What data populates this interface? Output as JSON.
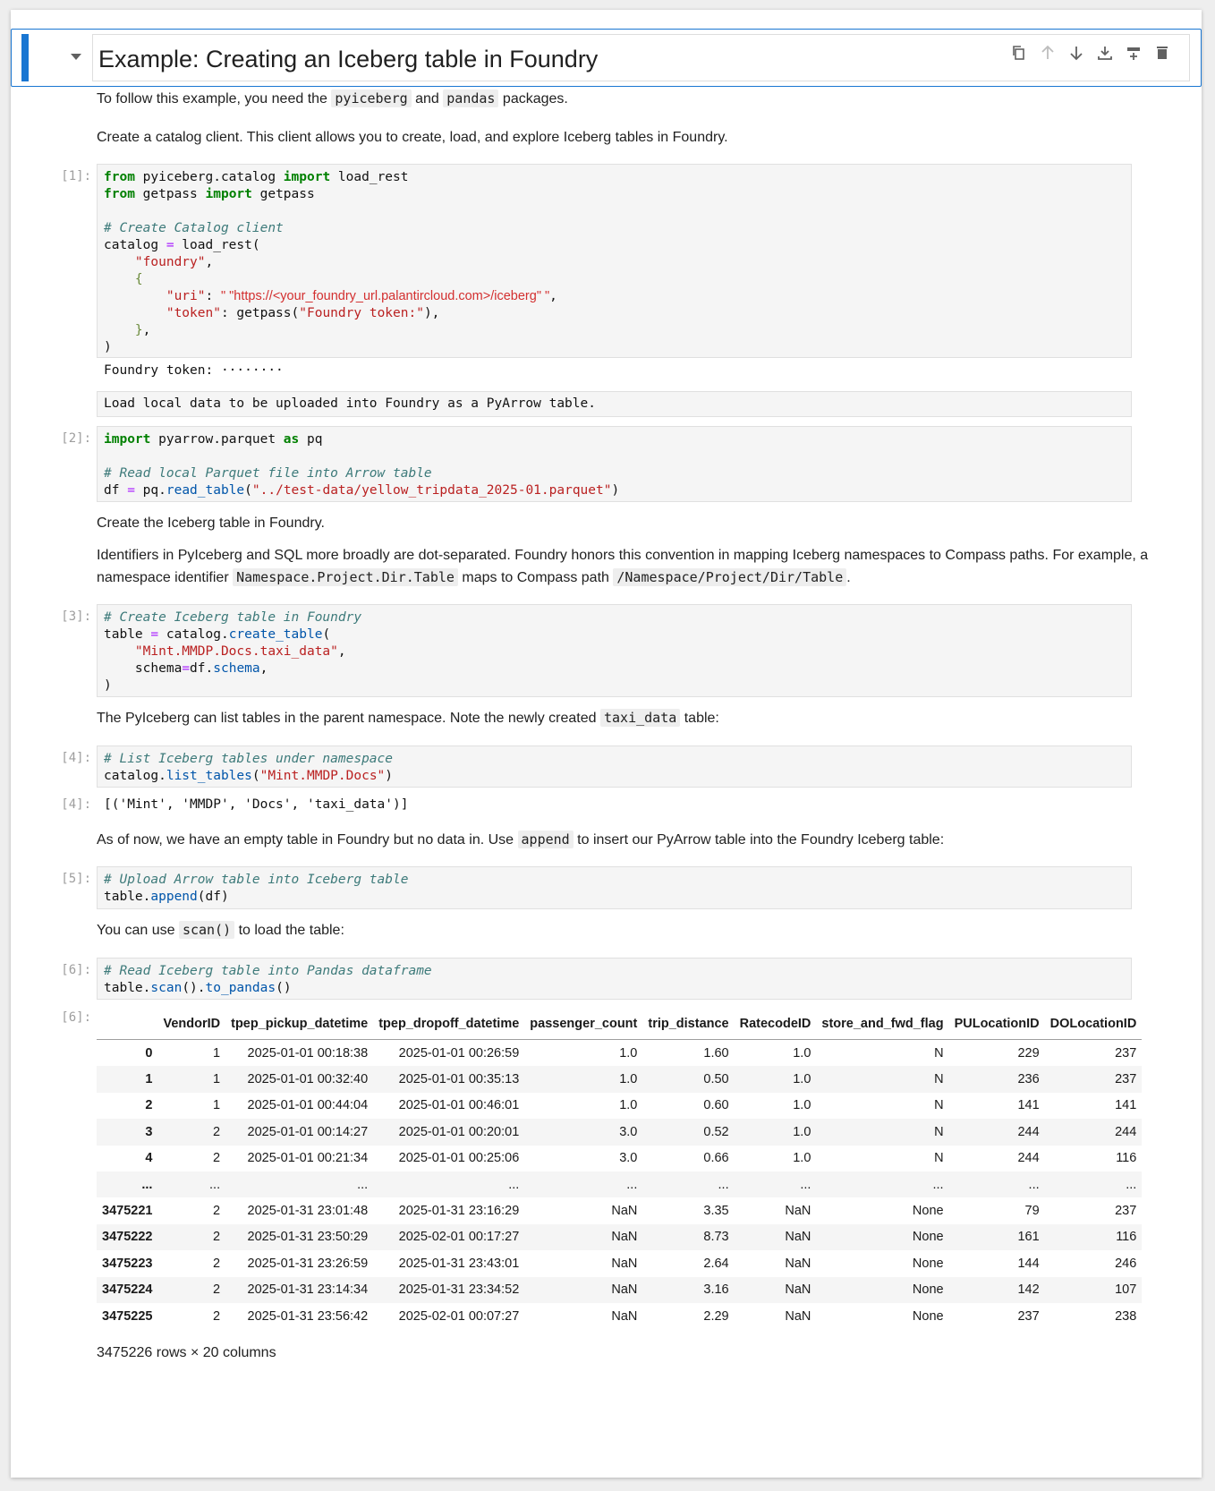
{
  "title": "Example: Creating an Iceberg table in Foundry",
  "toolbar": [
    "copy-icon",
    "move-up-icon",
    "move-down-icon",
    "insert-below-icon",
    "insert-above-icon",
    "delete-icon"
  ],
  "md1": {
    "pre": "To follow this example, you need the",
    "code1": "pyiceberg",
    "mid": "and",
    "code2": "pandas",
    "post": "packages."
  },
  "md2": "Create a catalog client. This client allows you to create, load, and explore Iceberg tables in Foundry.",
  "cell1": {
    "prompt": "[1]:",
    "comment": "# Create Catalog client",
    "foundry": "\"foundry\"",
    "uri_key": "\"uri\"",
    "uri_value": "\" \"https://<your_foundry_url.palantircloud.com>/iceberg\" \"",
    "token_key": "\"token\"",
    "token_prompt": "\"Foundry token:\""
  },
  "out1": "Foundry token: ········",
  "raw1": "Load local data to be uploaded into Foundry as a PyArrow table.",
  "cell2": {
    "prompt": "[2]:",
    "comment": "# Read local Parquet file into Arrow table",
    "path": "\"../test-data/yellow_tripdata_2025-01.parquet\""
  },
  "md3": "Create the Iceberg table in Foundry.",
  "md4": {
    "line1": "Identifiers in PyIceberg and SQL more broadly are dot-separated. Foundry honors this convention in mapping Iceberg namespaces to Compass paths. For example, a",
    "pre": "namespace identifier",
    "code1": "Namespace.Project.Dir.Table",
    "mid": "maps to Compass path",
    "code2": "/Namespace/Project/Dir/Table",
    "post": "."
  },
  "cell3": {
    "prompt": "[3]:",
    "comment": "# Create Iceberg table in Foundry",
    "name": "\"Mint.MMDP.Docs.taxi_data\""
  },
  "md5": {
    "pre": "The PyIceberg can list tables in the parent namespace. Note the newly created",
    "code": "taxi_data",
    "post": "table:"
  },
  "cell4": {
    "prompt": "[4]:",
    "comment": "# List Iceberg tables under namespace",
    "ns": "\"Mint.MMDP.Docs\""
  },
  "out4": {
    "prompt": "[4]:",
    "text": "[('Mint', 'MMDP', 'Docs', 'taxi_data')]"
  },
  "md6": {
    "pre": "As of now, we have an empty table in Foundry but no data in. Use",
    "code": "append",
    "post": "to insert our PyArrow table into the Foundry Iceberg table:"
  },
  "cell5": {
    "prompt": "[5]:",
    "comment": "# Upload Arrow table into Iceberg table"
  },
  "md7": {
    "pre": "You can use",
    "code": "scan()",
    "post": "to load the table:"
  },
  "cell6": {
    "prompt": "[6]:",
    "comment": "# Read Iceberg table into Pandas dataframe"
  },
  "out6": {
    "prompt": "[6]:",
    "columns": [
      "",
      "VendorID",
      "tpep_pickup_datetime",
      "tpep_dropoff_datetime",
      "passenger_count",
      "trip_distance",
      "RatecodeID",
      "store_and_fwd_flag",
      "PULocationID",
      "DOLocationID"
    ],
    "rows": [
      [
        "0",
        "1",
        "2025-01-01 00:18:38",
        "2025-01-01 00:26:59",
        "1.0",
        "1.60",
        "1.0",
        "N",
        "229",
        "237"
      ],
      [
        "1",
        "1",
        "2025-01-01 00:32:40",
        "2025-01-01 00:35:13",
        "1.0",
        "0.50",
        "1.0",
        "N",
        "236",
        "237"
      ],
      [
        "2",
        "1",
        "2025-01-01 00:44:04",
        "2025-01-01 00:46:01",
        "1.0",
        "0.60",
        "1.0",
        "N",
        "141",
        "141"
      ],
      [
        "3",
        "2",
        "2025-01-01 00:14:27",
        "2025-01-01 00:20:01",
        "3.0",
        "0.52",
        "1.0",
        "N",
        "244",
        "244"
      ],
      [
        "4",
        "2",
        "2025-01-01 00:21:34",
        "2025-01-01 00:25:06",
        "3.0",
        "0.66",
        "1.0",
        "N",
        "244",
        "116"
      ],
      [
        "...",
        "...",
        "...",
        "...",
        "...",
        "...",
        "...",
        "...",
        "...",
        "..."
      ],
      [
        "3475221",
        "2",
        "2025-01-31 23:01:48",
        "2025-01-31 23:16:29",
        "NaN",
        "3.35",
        "NaN",
        "None",
        "79",
        "237"
      ],
      [
        "3475222",
        "2",
        "2025-01-31 23:50:29",
        "2025-02-01 00:17:27",
        "NaN",
        "8.73",
        "NaN",
        "None",
        "161",
        "116"
      ],
      [
        "3475223",
        "2",
        "2025-01-31 23:26:59",
        "2025-01-31 23:43:01",
        "NaN",
        "2.64",
        "NaN",
        "None",
        "144",
        "246"
      ],
      [
        "3475224",
        "2",
        "2025-01-31 23:14:34",
        "2025-01-31 23:34:52",
        "NaN",
        "3.16",
        "NaN",
        "None",
        "142",
        "107"
      ],
      [
        "3475225",
        "2",
        "2025-01-31 23:56:42",
        "2025-02-01 00:07:27",
        "NaN",
        "2.29",
        "NaN",
        "None",
        "237",
        "238"
      ]
    ],
    "footer": "3475226 rows × 20 columns"
  }
}
